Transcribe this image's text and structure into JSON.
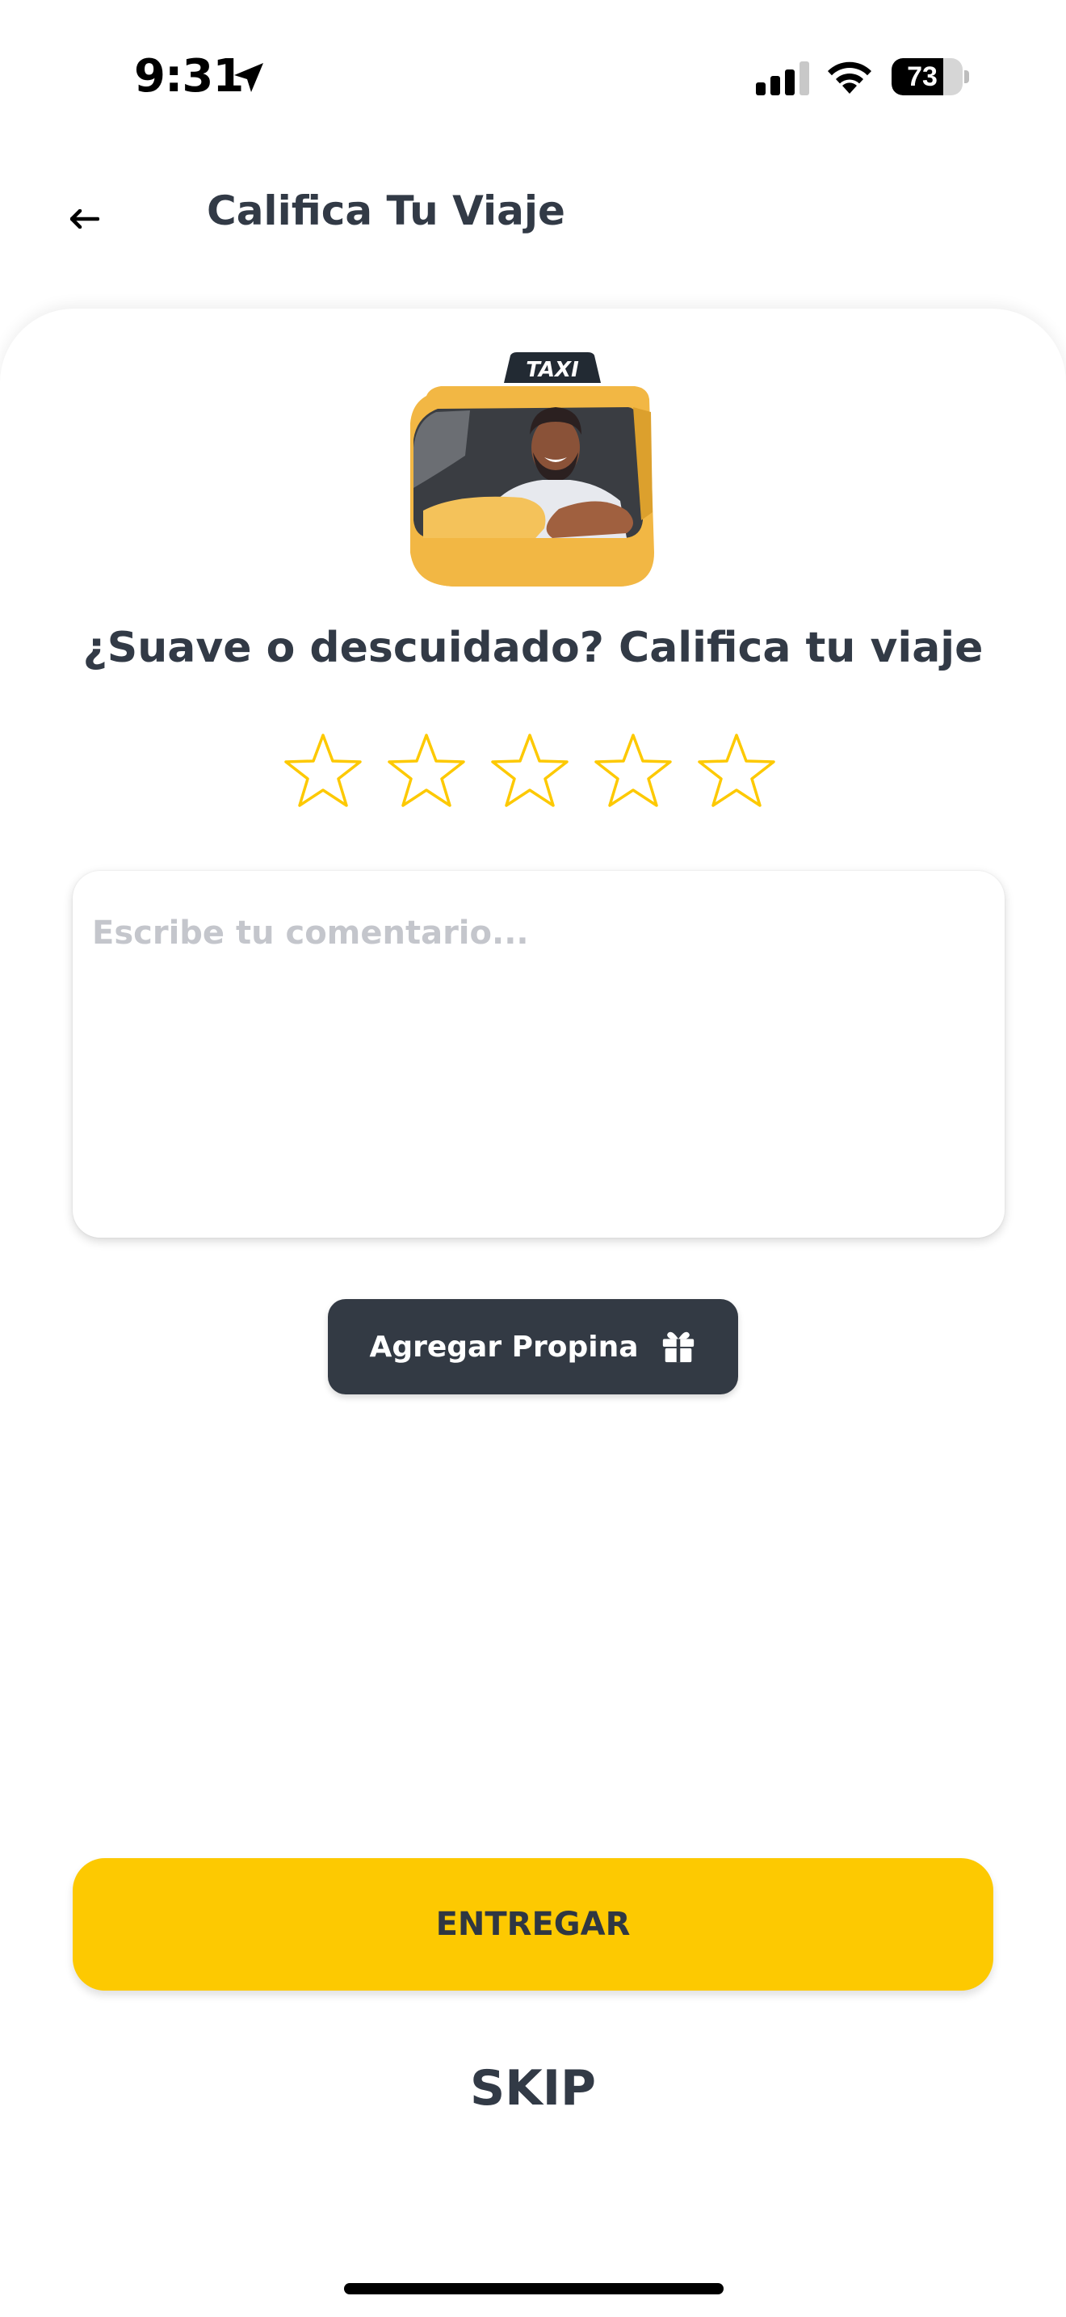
{
  "status_bar": {
    "time": "9:31",
    "battery_level": "73",
    "battery_fraction": 0.73,
    "icons": [
      "location-arrow-icon",
      "cellular-signal-icon",
      "wifi-icon",
      "battery-icon"
    ]
  },
  "header": {
    "back_icon": "arrow-left-icon",
    "title": "Califica Tu Viaje"
  },
  "rating": {
    "illustration": "taxi-driver-illustration",
    "question": "¿Suave o descuidado? Califica tu viaje",
    "max_stars": 5,
    "selected_stars": 0,
    "star_color": "#fdc901"
  },
  "comment": {
    "placeholder": "Escribe tu comentario...",
    "value": ""
  },
  "tip": {
    "label": "Agregar Propina",
    "icon": "gift-icon"
  },
  "actions": {
    "submit_label": "ENTREGAR",
    "skip_label": "SKIP"
  },
  "colors": {
    "accent": "#fdc901",
    "dark": "#333a44",
    "text": "#323a46",
    "placeholder": "#c4c6cc"
  }
}
